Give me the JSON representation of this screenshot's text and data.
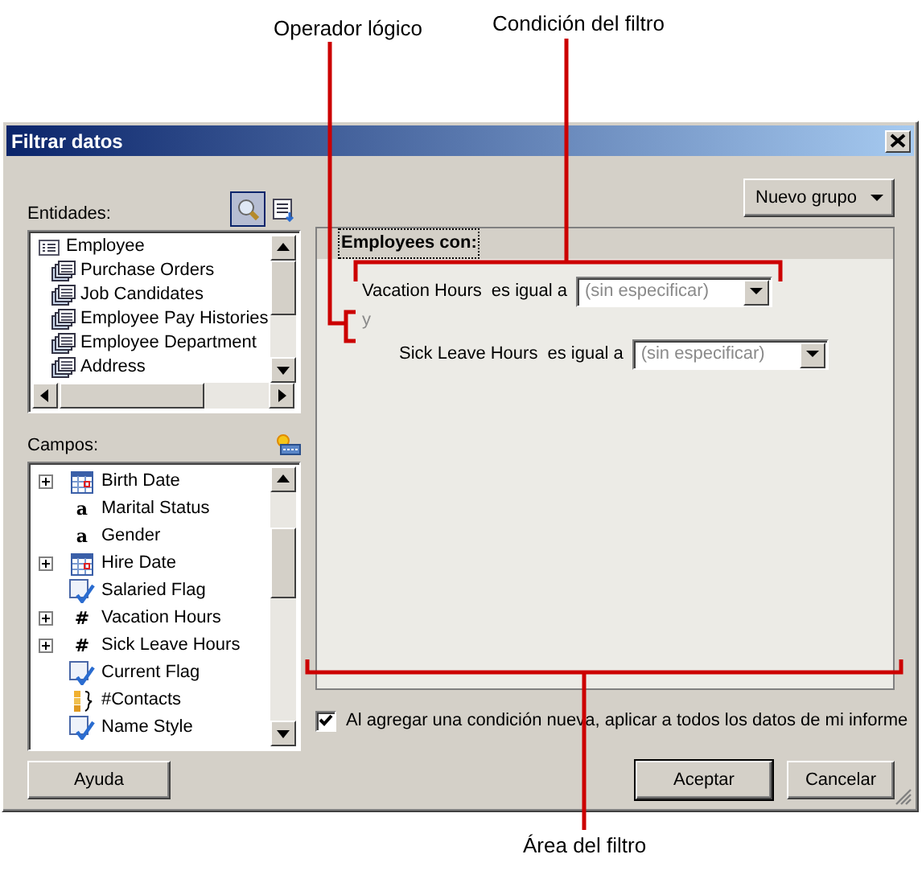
{
  "annotations": [
    {
      "label": "Operador lógico"
    },
    {
      "label": "Condición del filtro"
    },
    {
      "label": "Área del filtro"
    }
  ],
  "window": {
    "title": "Filtrar datos"
  },
  "toolbar": [
    {
      "kind": "search",
      "selected": true
    },
    {
      "kind": "list",
      "selected": false
    }
  ],
  "entities": {
    "label": "Entidades:",
    "items": [
      {
        "label": "Employee",
        "children": [
          {
            "label": "Purchase Orders"
          },
          {
            "label": "Job Candidates"
          },
          {
            "label": "Employee Pay Histories"
          },
          {
            "label": "Employee Department"
          },
          {
            "label": "Address"
          }
        ]
      }
    ]
  },
  "fields": {
    "label": "Campos:",
    "items": [
      {
        "label": "Birth Date",
        "kind": "date",
        "expandable": true
      },
      {
        "label": "Marital Status",
        "kind": "glyph",
        "glyph": "a",
        "expandable": false
      },
      {
        "label": "Gender",
        "kind": "glyph",
        "glyph": "a",
        "expandable": false
      },
      {
        "label": "Hire Date",
        "kind": "date",
        "expandable": true
      },
      {
        "label": "Salaried Flag",
        "kind": "flag",
        "expandable": false
      },
      {
        "label": "Vacation Hours",
        "kind": "glyph",
        "glyph": "#",
        "expandable": true
      },
      {
        "label": "Sick Leave Hours",
        "kind": "glyph",
        "glyph": "#",
        "expandable": true
      },
      {
        "label": "Current Flag",
        "kind": "flag",
        "expandable": false
      },
      {
        "label": "#Contacts",
        "kind": "aggregate",
        "expandable": false
      },
      {
        "label": "Name Style",
        "kind": "flag",
        "expandable": false
      }
    ]
  },
  "new_group_button": "Nuevo grupo",
  "filter": {
    "heading": "Employees con:",
    "items": [
      {
        "kind": "condition",
        "field": "Vacation Hours",
        "operator": "es igual a",
        "placeholder": "(sin especificar)"
      },
      {
        "kind": "operator",
        "label": "y"
      },
      {
        "kind": "condition",
        "field": "Sick Leave Hours",
        "operator": "es igual a",
        "placeholder": "(sin especificar)"
      }
    ]
  },
  "apply_all": {
    "label": "Al agregar una condición nueva, aplicar a todos los datos de mi informe",
    "checked": true
  },
  "buttons": {
    "help": "Ayuda",
    "ok": "Aceptar",
    "cancel": "Cancelar"
  }
}
